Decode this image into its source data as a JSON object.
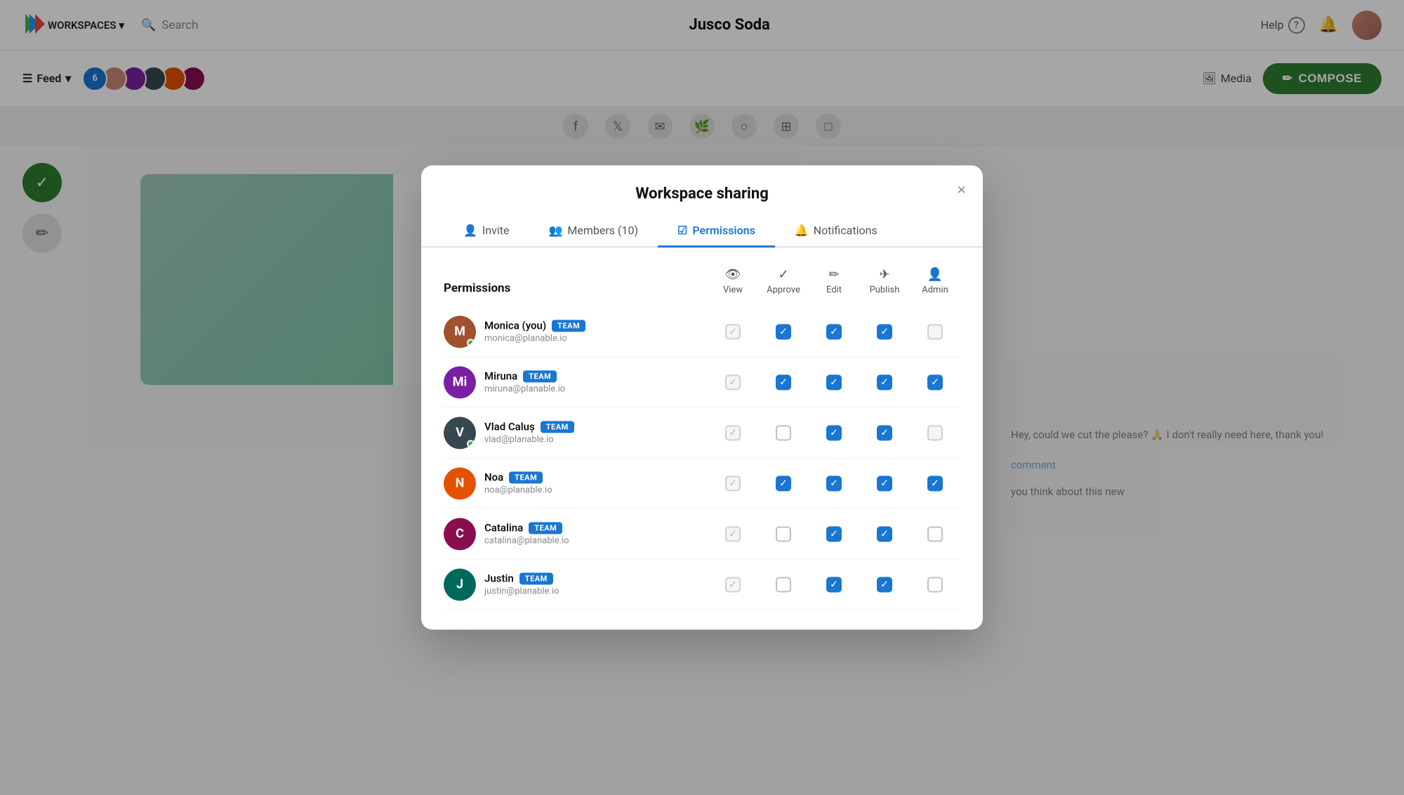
{
  "app": {
    "title": "Jusco Soda",
    "workspaces_label": "WORKSPACES",
    "search_placeholder": "Search",
    "help_label": "Help",
    "feed_label": "Feed",
    "media_label": "Media",
    "compose_label": "COMPOSE",
    "avatar_count": "6"
  },
  "modal": {
    "title": "Workspace sharing",
    "close_label": "×",
    "tabs": [
      {
        "id": "invite",
        "label": "Invite",
        "icon": "👤",
        "active": false
      },
      {
        "id": "members",
        "label": "Members (10)",
        "icon": "👥",
        "active": false
      },
      {
        "id": "permissions",
        "label": "Permissions",
        "icon": "☑",
        "active": true
      },
      {
        "id": "notifications",
        "label": "Notifications",
        "icon": "🔔",
        "active": false
      }
    ],
    "permissions": {
      "section_label": "Permissions",
      "columns": [
        {
          "id": "view",
          "label": "View",
          "icon": "👁"
        },
        {
          "id": "approve",
          "label": "Approve",
          "icon": "✓"
        },
        {
          "id": "edit",
          "label": "Edit",
          "icon": "✏"
        },
        {
          "id": "publish",
          "label": "Publish",
          "icon": "✈"
        },
        {
          "id": "admin",
          "label": "Admin",
          "icon": "👤"
        }
      ],
      "users": [
        {
          "name": "Monica (you)",
          "badge": "TEAM",
          "email": "monica@planable.io",
          "online": true,
          "avatar_color": "av-brown",
          "initials": "M",
          "checks": [
            "disabled-checked",
            "checked",
            "checked",
            "checked",
            "disabled"
          ]
        },
        {
          "name": "Miruna",
          "badge": "TEAM",
          "email": "miruna@planable.io",
          "online": false,
          "avatar_color": "av-purple",
          "initials": "Mi",
          "checks": [
            "disabled-checked",
            "checked",
            "checked",
            "checked",
            "checked"
          ]
        },
        {
          "name": "Vlad Caluș",
          "badge": "TEAM",
          "email": "vlad@planable.io",
          "online": true,
          "avatar_color": "av-dark",
          "initials": "V",
          "checks": [
            "disabled-checked",
            "unchecked",
            "checked",
            "checked",
            "disabled"
          ]
        },
        {
          "name": "Noa",
          "badge": "TEAM",
          "email": "noa@planable.io",
          "online": false,
          "avatar_color": "av-orange",
          "initials": "N",
          "checks": [
            "disabled-checked",
            "checked",
            "checked",
            "checked",
            "checked"
          ]
        },
        {
          "name": "Catalina",
          "badge": "TEAM",
          "email": "catalina@planable.io",
          "online": false,
          "avatar_color": "av-wine",
          "initials": "C",
          "checks": [
            "disabled-checked",
            "unchecked",
            "checked",
            "checked",
            "unchecked-large"
          ]
        },
        {
          "name": "Justin",
          "badge": "TEAM",
          "email": "justin@planable.io",
          "online": false,
          "avatar_color": "av-teal",
          "initials": "J",
          "checks": [
            "disabled-checked",
            "unchecked",
            "checked",
            "checked",
            "unchecked-large"
          ]
        }
      ]
    }
  },
  "background": {
    "comment_text": "Hey, could we cut the please? 🙏 I don't really need here, thank you!",
    "comment_link": "comment",
    "comment_text2": "you think about this new"
  }
}
